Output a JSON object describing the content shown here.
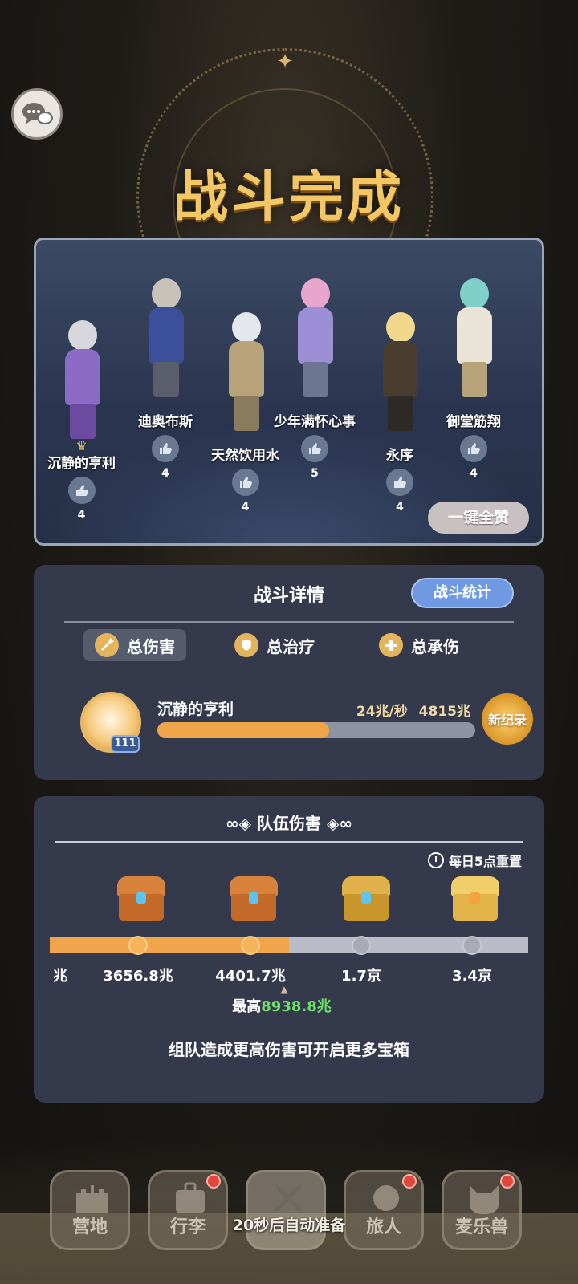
{
  "title": "战斗完成",
  "team": {
    "heroes": [
      {
        "name": "沉静的亨利",
        "likes": "4",
        "mvp": true
      },
      {
        "name": "迪奥布斯",
        "likes": "4"
      },
      {
        "name": "天然饮用水",
        "likes": "4"
      },
      {
        "name": "少年满怀心事",
        "likes": "5"
      },
      {
        "name": "永序",
        "likes": "4"
      },
      {
        "name": "御堂筋翔",
        "likes": "4"
      }
    ],
    "like_all_label": "一键全赞"
  },
  "details": {
    "title": "战斗详情",
    "stats_button": "战斗统计",
    "tabs": [
      {
        "label": "总伤害",
        "active": true
      },
      {
        "label": "总治疗",
        "active": false
      },
      {
        "label": "总承伤",
        "active": false
      }
    ],
    "player": {
      "name": "沉静的亨利",
      "level": "111",
      "dps": "24兆/秒",
      "total": "4815兆",
      "bar_fraction": 0.54,
      "record_badge": "新纪录"
    }
  },
  "team_damage": {
    "title": "队伍伤害",
    "reset_note": "每日5点重置",
    "progress_fraction": 0.5,
    "clipped_label": "兆",
    "thresholds": [
      {
        "label": "3656.8兆",
        "reached": true
      },
      {
        "label": "4401.7兆",
        "reached": true
      },
      {
        "label": "1.7京",
        "reached": false
      },
      {
        "label": "3.4京",
        "reached": false
      }
    ],
    "peak_prefix": "最高",
    "peak_value": "8938.8兆",
    "tip": "组队造成更高伤害可开启更多宝箱"
  },
  "nav": {
    "items": [
      {
        "label": "营地",
        "badge": false
      },
      {
        "label": "行李",
        "badge": true
      },
      {
        "label": "冒险",
        "badge": false
      },
      {
        "label": "旅人",
        "badge": true
      },
      {
        "label": "麦乐兽",
        "badge": true
      }
    ],
    "auto_ready": "20秒后自动准备"
  },
  "colors": {
    "title": "#f3c766",
    "accent_orange": "#f0a54a",
    "peak_green": "#6ee06a",
    "stats_blue": "#6f9ae3",
    "badge_red": "#e0463a"
  }
}
